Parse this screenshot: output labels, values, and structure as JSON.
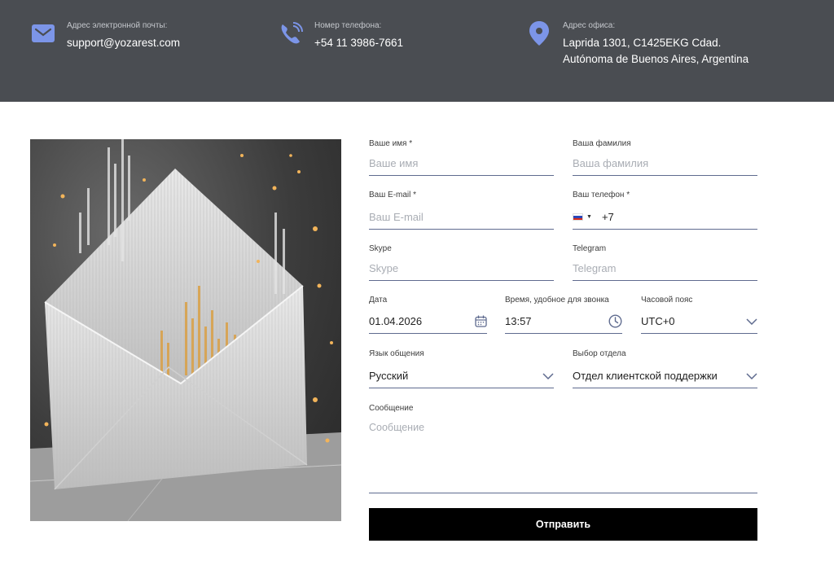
{
  "contacts": {
    "email": {
      "caption": "Адрес электронной почты:",
      "value": "support@yozarest.com"
    },
    "phone": {
      "caption": "Номер телефона:",
      "value": "+54 11 3986-7661"
    },
    "office": {
      "caption": "Адрес офиса:",
      "line1": "Laprida 1301, C1425EKG Cdad.",
      "line2": "Autónoma de Buenos Aires, Argentina"
    },
    "icon_color": "#7c95e8"
  },
  "form": {
    "first_name": {
      "label": "Ваше имя *",
      "placeholder": "Ваше имя"
    },
    "last_name": {
      "label": "Ваша фамилия",
      "placeholder": "Ваша фамилия"
    },
    "email": {
      "label": "Ваш E-mail *",
      "placeholder": "Ваш E-mail"
    },
    "phone": {
      "label": "Ваш телефон *",
      "prefix": "+7",
      "country": "RU"
    },
    "skype": {
      "label": "Skype",
      "placeholder": "Skype"
    },
    "telegram": {
      "label": "Telegram",
      "placeholder": "Telegram"
    },
    "date": {
      "label": "Дата",
      "value": "01.04.2026"
    },
    "time": {
      "label": "Время, удобное для звонка",
      "value": "13:57"
    },
    "timezone": {
      "label": "Часовой пояс",
      "value": "UTC+0"
    },
    "language": {
      "label": "Язык общения",
      "value": "Русский"
    },
    "department": {
      "label": "Выбор отдела",
      "value": "Отдел клиентской поддержки"
    },
    "message": {
      "label": "Сообщение",
      "placeholder": "Сообщение"
    },
    "submit_label": "Отправить"
  },
  "colors": {
    "accent": "#5f6b8f",
    "topbar": "#4a4d52",
    "button": "#000000"
  }
}
